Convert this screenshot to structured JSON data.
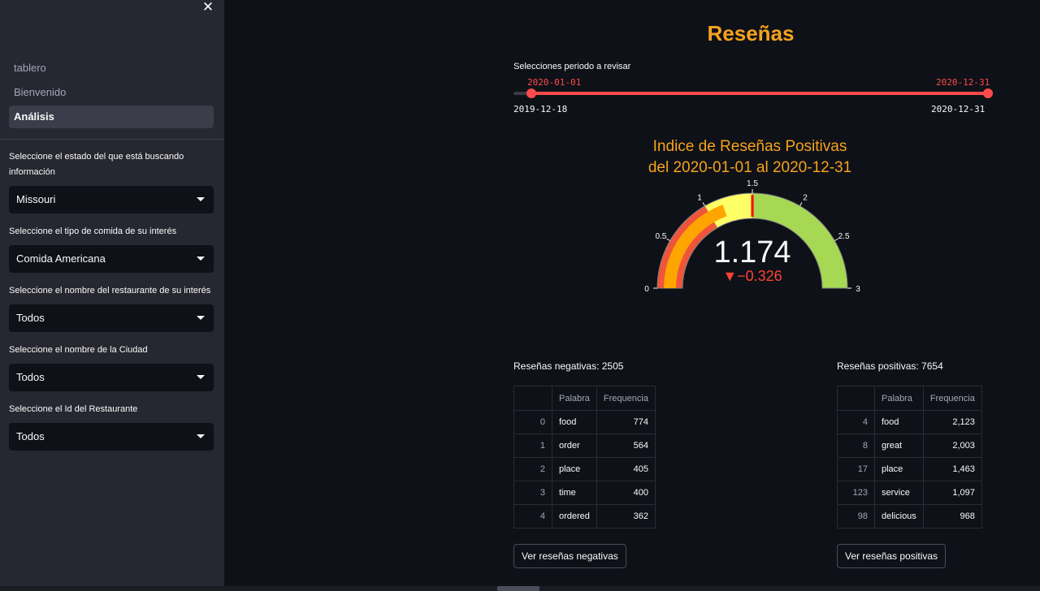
{
  "sidebar": {
    "nav": [
      "tablero",
      "Bienvenido",
      "Análisis"
    ],
    "active_nav": "Análisis",
    "filters": [
      {
        "label": "Seleccione el estado del que está buscando información",
        "value": "Missouri"
      },
      {
        "label": "Seleccione el tipo de comida de su interés",
        "value": "Comida Americana"
      },
      {
        "label": "Seleccione el nombre del restaurante de su interés",
        "value": "Todos"
      },
      {
        "label": "Seleccione el nombre de la Ciudad",
        "value": "Todos"
      },
      {
        "label": "Seleccione el Id del Restaurante",
        "value": "Todos"
      }
    ]
  },
  "main": {
    "title": "Reseñas",
    "slider": {
      "label": "Selecciones periodo a revisar",
      "min": "2019-12-18",
      "max": "2020-12-31",
      "value_start": "2020-01-01",
      "value_end": "2020-12-31"
    },
    "gauge": {
      "title_line1": "Indice de Reseñas Positivas",
      "title_line2": "del 2020-01-01 al 2020-12-31",
      "value": 1.174,
      "value_text": "1.174",
      "delta_text": "▼−0.326",
      "reference": 1.5,
      "range": [
        0,
        3
      ],
      "ticks": [
        "0",
        "0.5",
        "1",
        "1.5",
        "2",
        "2.5",
        "3"
      ],
      "steps": [
        {
          "range": [
            0,
            1
          ],
          "color": "#ef553b"
        },
        {
          "range": [
            1,
            1.5
          ],
          "color": "#ffff66"
        },
        {
          "range": [
            1.5,
            3
          ],
          "color": "#a6d854"
        }
      ],
      "bar_color": "#ffa500",
      "threshold_color": "#ff0000"
    },
    "negativas": {
      "heading": "Reseñas negativas: 2505",
      "columns": [
        "",
        "Palabra",
        "Frequencia"
      ],
      "rows": [
        [
          "0",
          "food",
          "774"
        ],
        [
          "1",
          "order",
          "564"
        ],
        [
          "2",
          "place",
          "405"
        ],
        [
          "3",
          "time",
          "400"
        ],
        [
          "4",
          "ordered",
          "362"
        ]
      ],
      "button": "Ver reseñas negativas"
    },
    "positivas": {
      "heading": "Reseñas positivas: 7654",
      "columns": [
        "",
        "Palabra",
        "Frequencia"
      ],
      "rows": [
        [
          "4",
          "food",
          "2,123"
        ],
        [
          "8",
          "great",
          "2,003"
        ],
        [
          "17",
          "place",
          "1,463"
        ],
        [
          "123",
          "service",
          "1,097"
        ],
        [
          "98",
          "delicious",
          "968"
        ]
      ],
      "button": "Ver reseñas positivas"
    }
  }
}
